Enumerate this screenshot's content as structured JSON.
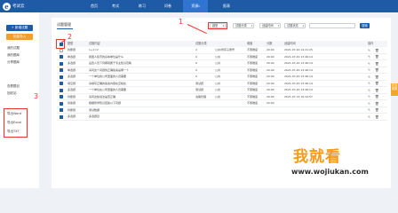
{
  "app": {
    "logo_letter": "e",
    "name": "考试云"
  },
  "nav": [
    {
      "label": "首页",
      "active": false
    },
    {
      "label": "考试",
      "active": false
    },
    {
      "label": "练习",
      "active": false
    },
    {
      "label": "问卷",
      "active": false
    },
    {
      "label": "资源",
      "active": true,
      "caret": "▾"
    },
    {
      "label": "报表",
      "active": false
    }
  ],
  "sidebar": {
    "buttons": [
      {
        "label": "+ 新增试题",
        "color": "#1f5aa6"
      },
      {
        "label": "批量导入",
        "color": "#f0a030"
      }
    ],
    "links_top": [
      "我的试题",
      "我的题库",
      "分享题库"
    ],
    "links_mid": [
      "查看题目",
      "回收站"
    ],
    "exports": [
      "导出Word",
      "导出Excel",
      "导出TXT"
    ]
  },
  "page": {
    "title": "试题管理"
  },
  "filters": [
    {
      "label": "题型",
      "caret": "▾"
    },
    {
      "label": "试题分类",
      "caret": "▾"
    },
    {
      "label": "创建时间",
      "caret": "▾"
    },
    {
      "label": "试题状态",
      "caret": "▾"
    }
  ],
  "search": {
    "label": "搜索"
  },
  "table": {
    "headers": [
      "题型",
      "试题内容",
      "试题分类",
      "难度",
      "分数",
      "创建时间",
      "操作"
    ],
    "rows": [
      {
        "type": "判断题",
        "content": "1+1=2",
        "category": "2",
        "scope": "公共/所有子账号",
        "difficulty": "不限难度",
        "score": "20.00",
        "time": "2021-07-20 14:21:25",
        "checked": false
      },
      {
        "type": "单选题",
        "content": "我国人民币的基本单位是什么",
        "category": "0",
        "scope": "公共",
        "difficulty": "不限难度",
        "score": "20.00",
        "time": "2021-07-20 13:46:14",
        "checked": true
      },
      {
        "type": "多选题",
        "content": "设置人员下列哪项属于专业知识范畴",
        "category": "0",
        "scope": "公共",
        "difficulty": "不限难度",
        "score": "20.00",
        "time": "2021-07-20 13:46:14",
        "checked": true
      },
      {
        "type": "单选题",
        "content": "请问这个问题的正确答案是哪一个",
        "category": "0",
        "scope": "公共",
        "difficulty": "不限难度",
        "score": "20.00",
        "time": "2021-07-20 13:46:14",
        "checked": true
      },
      {
        "type": "多选题",
        "content": "一个单位的公司里面的人员需要",
        "category": "0",
        "scope": "公共",
        "difficulty": "不限难度",
        "score": "20.00",
        "time": "2021-07-20 13:46:14",
        "checked": true
      },
      {
        "type": "填空题",
        "content": "请填写正确的答案内容在空格处",
        "category": "测试题",
        "scope": "公共",
        "difficulty": "不限难度",
        "score": "20.00",
        "time": "2021-07-20 13:46:14",
        "checked": true
      },
      {
        "type": "多选题",
        "content": "一个单位在公司里面的人员需要",
        "category": "测试题",
        "scope": "公共",
        "difficulty": "不限难度",
        "score": "20.00",
        "time": "2021-07-20 13:46:14",
        "checked": true
      },
      {
        "type": "判断题",
        "content": "请问这些说法是否正确",
        "category": "决策管理",
        "scope": "公共",
        "difficulty": "不限难度",
        "score": "20.00",
        "time": "2021-07-13 10:22:57",
        "checked": true
      },
      {
        "type": "简答题",
        "content": "根据所学知识回答以下问题",
        "category": "",
        "scope": "",
        "difficulty": "不限难度",
        "score": "20.00",
        "time": "",
        "checked": true
      },
      {
        "type": "判断题",
        "content": "测试数据",
        "category": "",
        "scope": "",
        "difficulty": "",
        "score": "",
        "time": "",
        "checked": true
      },
      {
        "type": "多选题",
        "content": "多选题目",
        "category": "",
        "scope": "",
        "difficulty": "",
        "score": "",
        "time": "",
        "checked": true
      }
    ]
  },
  "annotations": [
    "1",
    "2",
    "3"
  ],
  "side_tab": {
    "label": "在线客服"
  },
  "watermark": {
    "big": "我就看",
    "small": "www.wojiukan.com"
  }
}
